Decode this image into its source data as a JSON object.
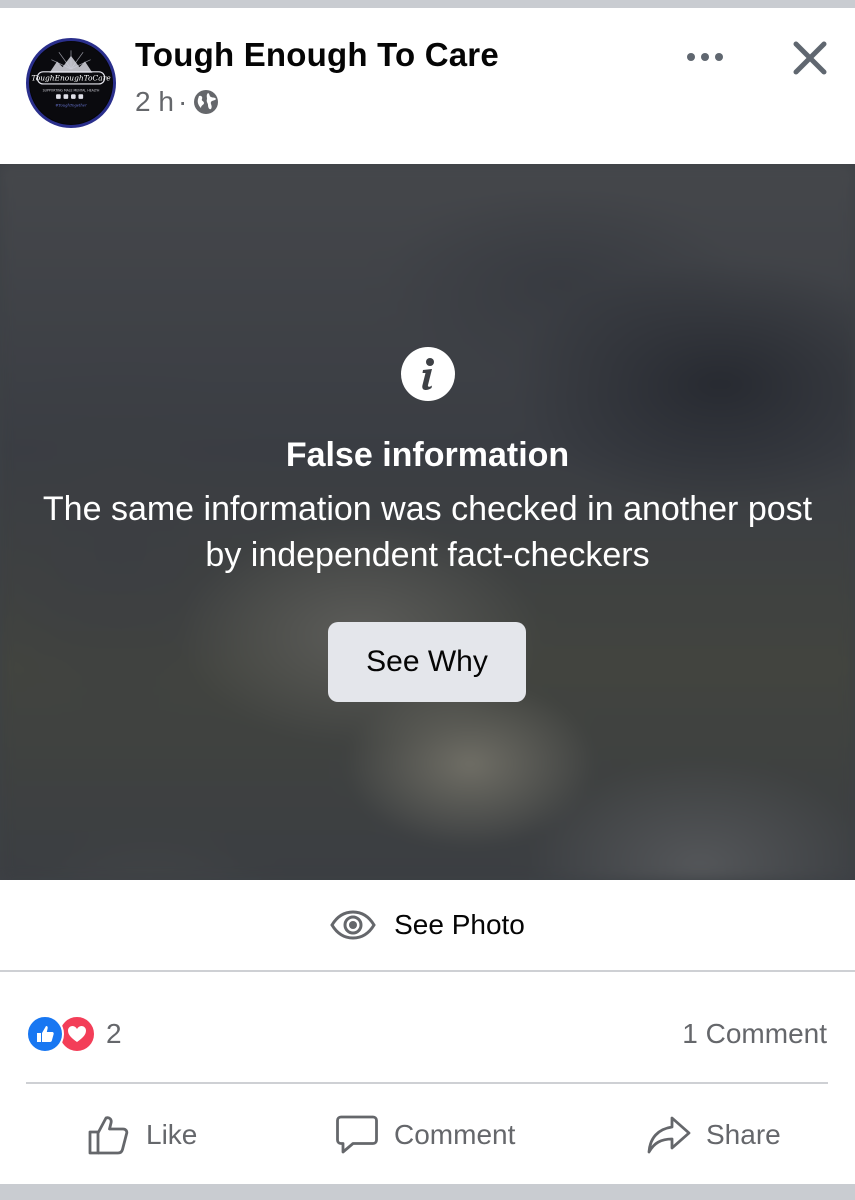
{
  "post": {
    "page_name": "Tough Enough To Care",
    "time": "2 h",
    "separator": "·",
    "privacy_icon": "globe-icon",
    "avatar_text": {
      "logo": "ToughEnoughToCare",
      "tagline": "SUPPORTING MALE MENTAL HEALTH",
      "hashtag": "#ToughTogether"
    }
  },
  "header_actions": {
    "more_icon": "more-dots-icon",
    "close_icon": "close-icon"
  },
  "warning": {
    "icon": "info-icon",
    "title": "False information",
    "text": "The same information was checked in another post by independent fact-checkers",
    "button_label": "See Why"
  },
  "see_photo": {
    "icon": "eye-icon",
    "label": "See Photo"
  },
  "stats": {
    "reaction_icons": [
      "like-reaction-icon",
      "love-reaction-icon"
    ],
    "reaction_count": "2",
    "comments": "1 Comment"
  },
  "actions": {
    "like": "Like",
    "comment": "Comment",
    "share": "Share"
  },
  "colors": {
    "like_blue": "#1877f2",
    "love_red": "#f33e58",
    "secondary_text": "#65676b",
    "button_bg": "#e4e6eb"
  }
}
